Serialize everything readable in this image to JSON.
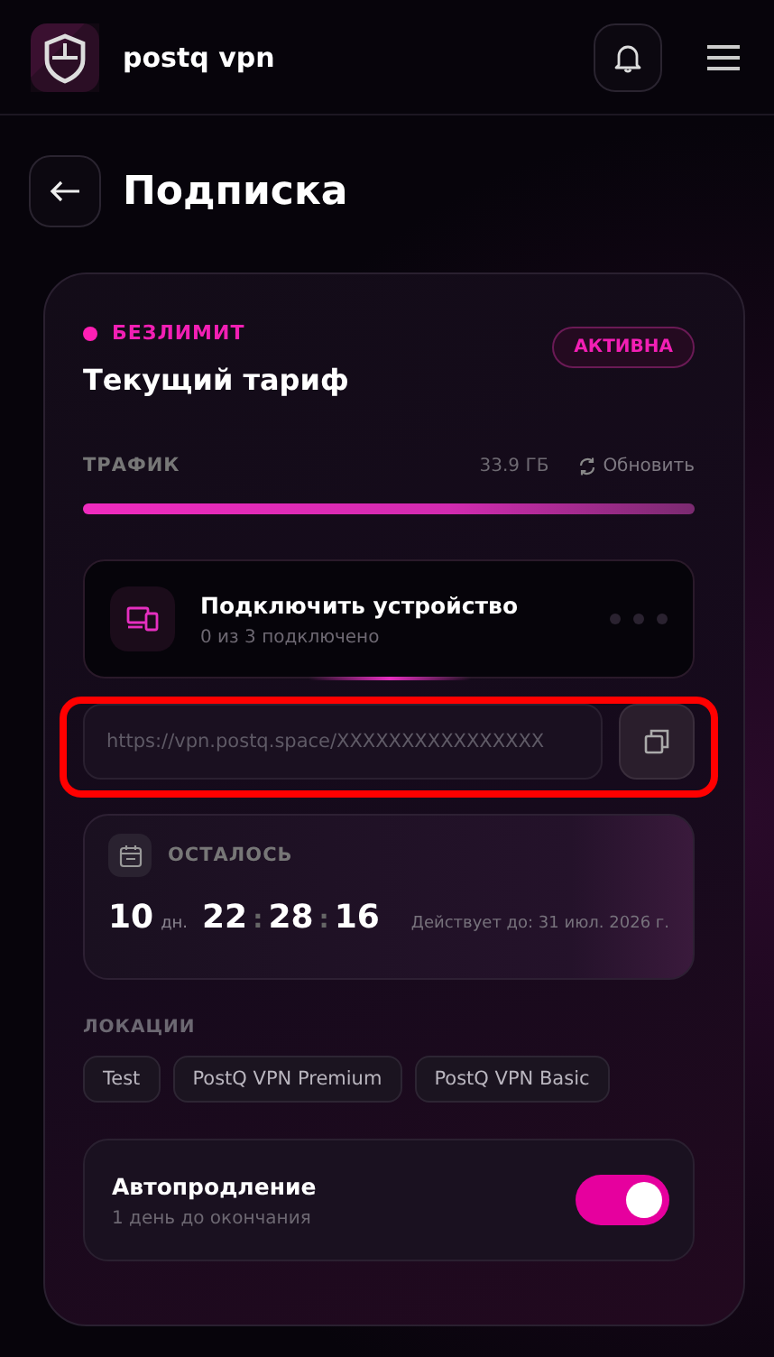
{
  "header": {
    "brand": "postq vpn"
  },
  "page": {
    "title": "Подписка"
  },
  "plan": {
    "badge": "БЕЗЛИМИТ",
    "title": "Текущий тариф",
    "status": "АКТИВНА"
  },
  "traffic": {
    "label": "ТРАФИК",
    "amount": "33.9 ГБ",
    "refresh": "Обновить",
    "level": 1
  },
  "device": {
    "title": "Подключить устройство",
    "subtitle": "0 из 3 подключено"
  },
  "link": {
    "value": "https://vpn.postq.space/XXXXXXXXXXXXXXXX",
    "highlighted": true
  },
  "remaining": {
    "label": "ОСТАЛОСЬ",
    "days": "10",
    "days_unit": "дн.",
    "hours": "22",
    "minutes": "28",
    "seconds": "16",
    "separator": ":",
    "valid_until": "Действует до: 31 июл. 2026 г."
  },
  "locations": {
    "label": "ЛОКАЦИИ",
    "items": [
      "Test",
      "PostQ VPN Premium",
      "PostQ VPN Basic"
    ]
  },
  "autorenew": {
    "title": "Автопродление",
    "subtitle": "1 день до окончания",
    "on": true
  }
}
